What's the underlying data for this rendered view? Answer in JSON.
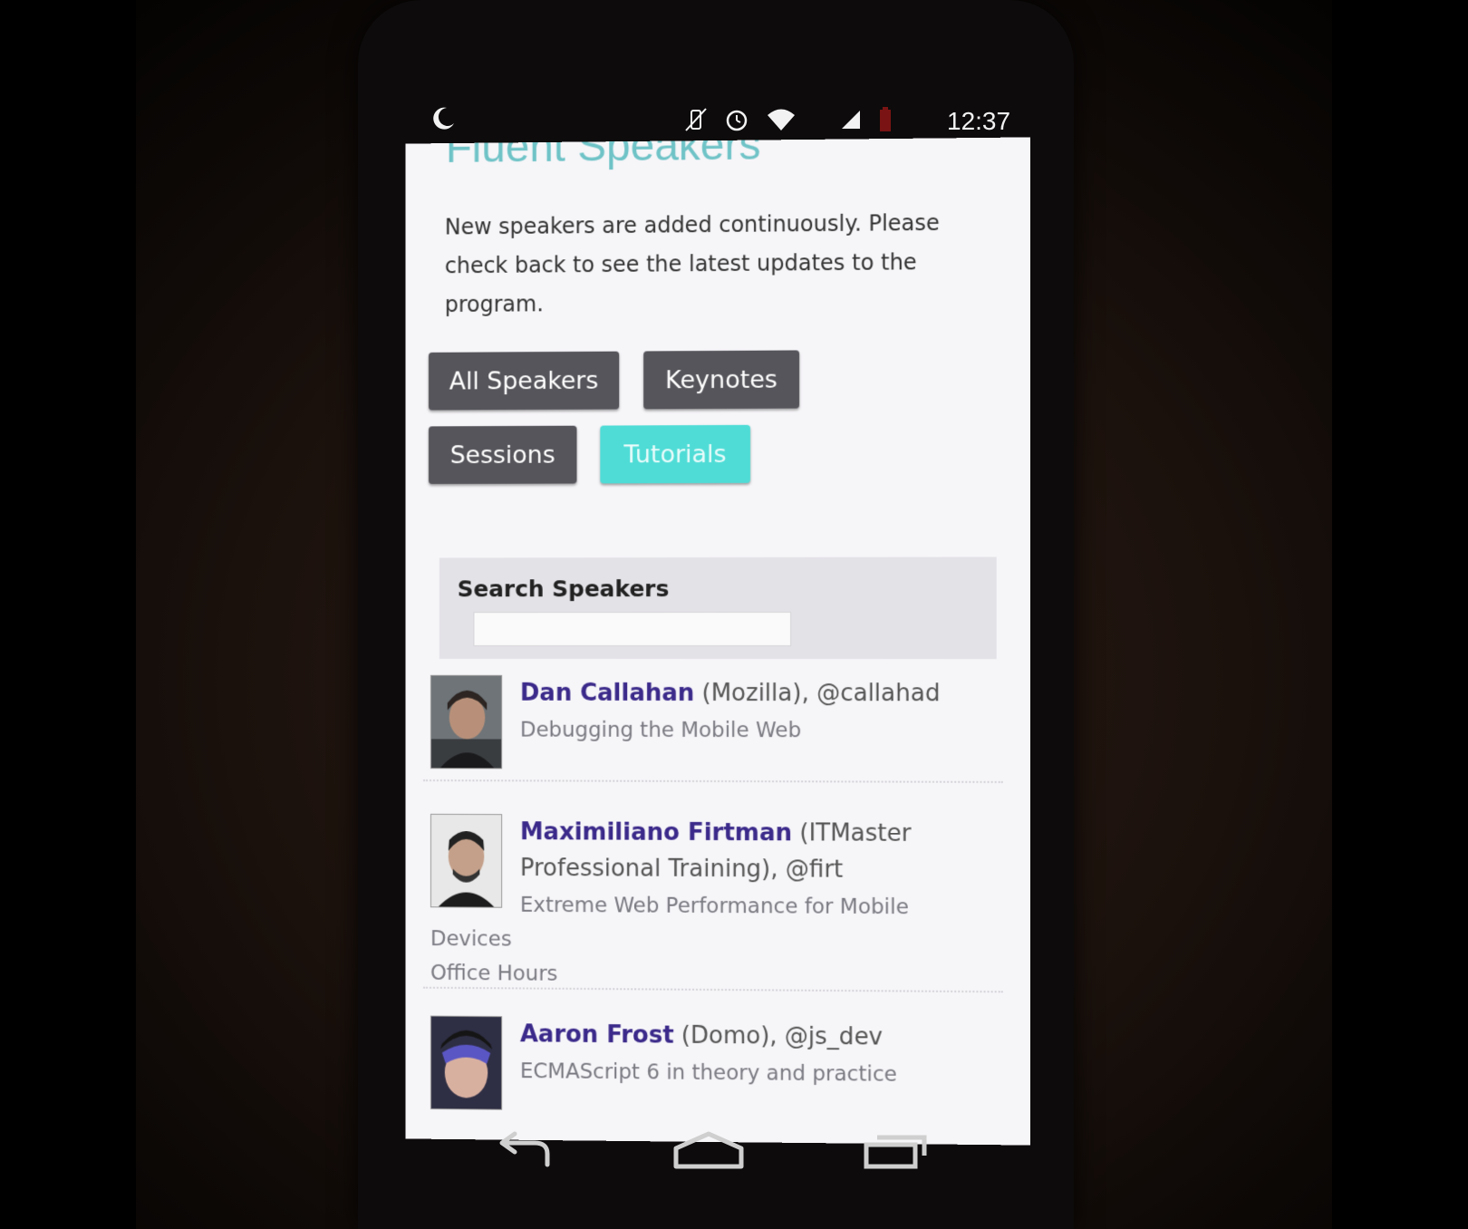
{
  "status_bar": {
    "time": "12:37",
    "left_icons": [
      "moon-icon"
    ],
    "right_icons": [
      "vibrate-icon",
      "alarm-icon",
      "wifi-icon",
      "signal-icon",
      "battery-icon"
    ]
  },
  "page": {
    "title": "Fluent Speakers",
    "intro": "New speakers are added continuously. Please check back to see the latest updates to the program."
  },
  "filters": [
    {
      "label": "All Speakers",
      "active": false
    },
    {
      "label": "Keynotes",
      "active": false
    },
    {
      "label": "Sessions",
      "active": false
    },
    {
      "label": "Tutorials",
      "active": true
    }
  ],
  "search": {
    "label": "Search Speakers",
    "value": "",
    "placeholder": ""
  },
  "speakers": [
    {
      "name": "Dan Callahan",
      "affiliation": " (Mozilla), @callahad",
      "talks": [
        "Debugging the Mobile Web"
      ]
    },
    {
      "name": "Maximiliano Firtman",
      "affiliation": " (ITMaster Professional Training), @firt",
      "talks": [
        "Extreme Web Performance for Mobile Devices",
        "Office Hours"
      ]
    },
    {
      "name": "Aaron Frost",
      "affiliation": " (Domo), @js_dev",
      "talks": [
        "ECMAScript 6 in theory and practice"
      ]
    }
  ],
  "nav_bar": [
    "back-icon",
    "home-icon",
    "recents-icon"
  ],
  "colors": {
    "title": "#6fc3c7",
    "button_dark": "#55555b",
    "button_active": "#4fdcd6",
    "speaker_name": "#3b2a8a"
  }
}
